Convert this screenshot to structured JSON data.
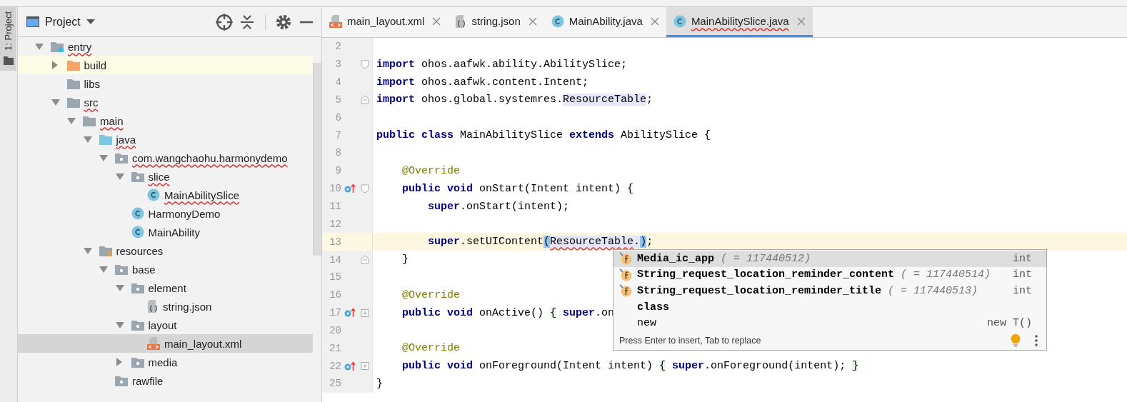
{
  "side_strip": {
    "tab": {
      "label": "1: Project",
      "selected": true
    }
  },
  "project_panel": {
    "title": "Project",
    "tree": [
      {
        "label": "entry",
        "kind": "module",
        "expanded": true,
        "selected": false,
        "highlighted": false,
        "misspelled": true,
        "children": [
          {
            "label": "build",
            "kind": "excluded-folder",
            "expanded": false,
            "selected": false,
            "highlighted": true,
            "misspelled": false
          },
          {
            "label": "libs",
            "kind": "folder",
            "selected": false,
            "highlighted": false,
            "misspelled": false
          },
          {
            "label": "src",
            "kind": "folder",
            "expanded": true,
            "selected": false,
            "highlighted": false,
            "misspelled": true,
            "children": [
              {
                "label": "main",
                "kind": "folder",
                "expanded": true,
                "selected": false,
                "highlighted": false,
                "misspelled": true,
                "children": [
                  {
                    "label": "java",
                    "kind": "source-folder",
                    "expanded": true,
                    "selected": false,
                    "highlighted": false,
                    "misspelled": true,
                    "children": [
                      {
                        "label": "com.wangchaohu.harmonydemo",
                        "kind": "package",
                        "expanded": true,
                        "selected": false,
                        "highlighted": false,
                        "misspelled": true,
                        "children": [
                          {
                            "label": "slice",
                            "kind": "package",
                            "expanded": true,
                            "selected": false,
                            "highlighted": false,
                            "misspelled": true,
                            "children": [
                              {
                                "label": "MainAbilitySlice",
                                "kind": "class",
                                "selected": false,
                                "highlighted": false,
                                "misspelled": true
                              }
                            ]
                          },
                          {
                            "label": "HarmonyDemo",
                            "kind": "class",
                            "selected": false,
                            "highlighted": false,
                            "misspelled": false
                          },
                          {
                            "label": "MainAbility",
                            "kind": "class",
                            "selected": false,
                            "highlighted": false,
                            "misspelled": false
                          }
                        ]
                      }
                    ]
                  },
                  {
                    "label": "resources",
                    "kind": "resources-folder",
                    "expanded": true,
                    "selected": false,
                    "highlighted": false,
                    "misspelled": false,
                    "children": [
                      {
                        "label": "base",
                        "kind": "package",
                        "expanded": true,
                        "selected": false,
                        "highlighted": false,
                        "misspelled": false,
                        "children": [
                          {
                            "label": "element",
                            "kind": "package",
                            "expanded": true,
                            "selected": false,
                            "highlighted": false,
                            "misspelled": false,
                            "children": [
                              {
                                "label": "string.json",
                                "kind": "json-file",
                                "selected": false,
                                "highlighted": false,
                                "misspelled": false
                              }
                            ]
                          },
                          {
                            "label": "layout",
                            "kind": "package",
                            "expanded": true,
                            "selected": false,
                            "highlighted": false,
                            "misspelled": false,
                            "children": [
                              {
                                "label": "main_layout.xml",
                                "kind": "xml-file",
                                "selected": true,
                                "highlighted": false,
                                "misspelled": false
                              }
                            ]
                          },
                          {
                            "label": "media",
                            "kind": "package",
                            "expanded": false,
                            "selected": false,
                            "highlighted": false,
                            "misspelled": false
                          }
                        ]
                      },
                      {
                        "label": "rawfile",
                        "kind": "package",
                        "selected": false,
                        "highlighted": false,
                        "misspelled": false
                      }
                    ]
                  }
                ]
              }
            ]
          }
        ]
      }
    ]
  },
  "editor": {
    "tabs": [
      {
        "label": "main_layout.xml",
        "kind": "xml-file",
        "selected": false,
        "misspelled": false
      },
      {
        "label": "string.json",
        "kind": "json-file",
        "selected": false,
        "misspelled": false
      },
      {
        "label": "MainAbility.java",
        "kind": "class",
        "selected": false,
        "misspelled": false
      },
      {
        "label": "MainAbilitySlice.java",
        "kind": "class",
        "selected": true,
        "misspelled": true
      }
    ],
    "lines": [
      {
        "number": "2",
        "current": false,
        "override": false,
        "fold_start": false,
        "fold_end": false,
        "folded": false
      },
      {
        "number": "3",
        "current": false,
        "override": false,
        "fold_start": true,
        "fold_end": false,
        "folded": false,
        "segments": [
          {
            "text": "import",
            "kind": "keyword"
          },
          {
            "text": " ohos.aafwk.ability.AbilitySlice;",
            "kind": "plain"
          }
        ]
      },
      {
        "number": "4",
        "current": false,
        "override": false,
        "fold_start": false,
        "fold_end": false,
        "folded": false,
        "segments": [
          {
            "text": "import",
            "kind": "keyword"
          },
          {
            "text": " ohos.aafwk.content.Intent;",
            "kind": "plain"
          }
        ]
      },
      {
        "number": "5",
        "current": false,
        "override": false,
        "fold_start": false,
        "fold_end": true,
        "folded": false,
        "segments": [
          {
            "text": "import",
            "kind": "keyword"
          },
          {
            "text": " ohos.global.systemres.",
            "kind": "plain"
          },
          {
            "text": "ResourceTable",
            "kind": "reference"
          },
          {
            "text": ";",
            "kind": "plain"
          }
        ]
      },
      {
        "number": "6",
        "current": false,
        "override": false,
        "fold_start": false,
        "fold_end": false,
        "folded": false
      },
      {
        "number": "7",
        "current": false,
        "override": false,
        "fold_start": false,
        "fold_end": false,
        "folded": false,
        "segments": [
          {
            "text": "public",
            "kind": "keyword"
          },
          {
            "text": " class",
            "kind": "keyword"
          },
          {
            "text": " MainAbilitySlice ",
            "kind": "plain"
          },
          {
            "text": "extends",
            "kind": "keyword"
          },
          {
            "text": " AbilitySlice {",
            "kind": "plain"
          }
        ]
      },
      {
        "number": "8",
        "current": false,
        "override": false,
        "fold_start": false,
        "fold_end": false,
        "folded": false
      },
      {
        "number": "9",
        "current": false,
        "override": false,
        "fold_start": false,
        "fold_end": false,
        "folded": false,
        "segments": [
          {
            "text": "    @Override",
            "kind": "annotation"
          }
        ]
      },
      {
        "number": "10",
        "current": false,
        "override": true,
        "fold_start": true,
        "fold_end": false,
        "folded": false,
        "segments": [
          {
            "text": "    public",
            "kind": "keyword"
          },
          {
            "text": " void",
            "kind": "keyword"
          },
          {
            "text": " onStart(Intent intent) {",
            "kind": "plain"
          }
        ]
      },
      {
        "number": "11",
        "current": false,
        "override": false,
        "fold_start": false,
        "fold_end": false,
        "folded": false,
        "segments": [
          {
            "text": "        super",
            "kind": "keyword"
          },
          {
            "text": ".onStart(intent);",
            "kind": "plain"
          }
        ]
      },
      {
        "number": "12",
        "current": false,
        "override": false,
        "fold_start": false,
        "fold_end": false,
        "folded": false
      },
      {
        "number": "13",
        "current": true,
        "override": false,
        "fold_start": false,
        "fold_end": false,
        "folded": false,
        "segments": [
          {
            "text": "        super",
            "kind": "keyword"
          },
          {
            "text": ".setUIContent",
            "kind": "plain"
          },
          {
            "text": "(",
            "kind": "match"
          },
          {
            "text": "ResourceTable",
            "kind": "error"
          },
          {
            "text": ".",
            "kind": "reference"
          },
          {
            "text": ")",
            "kind": "match"
          },
          {
            "text": ";",
            "kind": "plain"
          }
        ]
      },
      {
        "number": "14",
        "current": false,
        "override": false,
        "fold_start": false,
        "fold_end": true,
        "folded": false,
        "segments": [
          {
            "text": "    }",
            "kind": "plain"
          }
        ]
      },
      {
        "number": "15",
        "current": false,
        "override": false,
        "fold_start": false,
        "fold_end": false,
        "folded": false
      },
      {
        "number": "16",
        "current": false,
        "override": false,
        "fold_start": false,
        "fold_end": false,
        "folded": false,
        "segments": [
          {
            "text": "    @Override",
            "kind": "annotation"
          }
        ]
      },
      {
        "number": "17",
        "current": false,
        "override": true,
        "fold_start": false,
        "fold_end": false,
        "folded": true,
        "segments": [
          {
            "text": "    public",
            "kind": "keyword"
          },
          {
            "text": " void",
            "kind": "keyword"
          },
          {
            "text": " onActive() ",
            "kind": "plain"
          },
          {
            "text": "{",
            "kind": "brace"
          },
          {
            "text": " super",
            "kind": "keyword"
          },
          {
            "text": ".on",
            "kind": "plain"
          }
        ]
      },
      {
        "number": "20",
        "current": false,
        "override": false,
        "fold_start": false,
        "fold_end": false,
        "folded": false
      },
      {
        "number": "21",
        "current": false,
        "override": false,
        "fold_start": false,
        "fold_end": false,
        "folded": false,
        "segments": [
          {
            "text": "    @Override",
            "kind": "annotation"
          }
        ]
      },
      {
        "number": "22",
        "current": false,
        "override": true,
        "fold_start": false,
        "fold_end": false,
        "folded": true,
        "segments": [
          {
            "text": "    public",
            "kind": "keyword"
          },
          {
            "text": " void",
            "kind": "keyword"
          },
          {
            "text": " onForeground(Intent intent) ",
            "kind": "plain"
          },
          {
            "text": "{",
            "kind": "brace"
          },
          {
            "text": " super",
            "kind": "keyword"
          },
          {
            "text": ".onForeground(intent); ",
            "kind": "plain"
          },
          {
            "text": "}",
            "kind": "brace"
          }
        ]
      },
      {
        "number": "25",
        "current": false,
        "override": false,
        "fold_start": false,
        "fold_end": false,
        "folded": false,
        "segments": [
          {
            "text": "}",
            "kind": "plain"
          }
        ]
      }
    ],
    "completion": {
      "items": [
        {
          "kind": "field",
          "name": "Media_ic_app",
          "detail": "( = 117440512)",
          "type": "int",
          "selected": true
        },
        {
          "kind": "field",
          "name": "String_request_location_reminder_content",
          "detail": "( = 117440514)",
          "type": "int",
          "selected": false
        },
        {
          "kind": "field",
          "name": "String_request_location_reminder_title",
          "detail": "( = 117440513)",
          "type": "int",
          "selected": false
        },
        {
          "kind": "keyword",
          "name": "class",
          "selected": false
        },
        {
          "kind": "plain",
          "name": "new",
          "type": "new T()",
          "selected": false
        }
      ],
      "hint": "Press Enter to insert, Tab to replace"
    }
  }
}
